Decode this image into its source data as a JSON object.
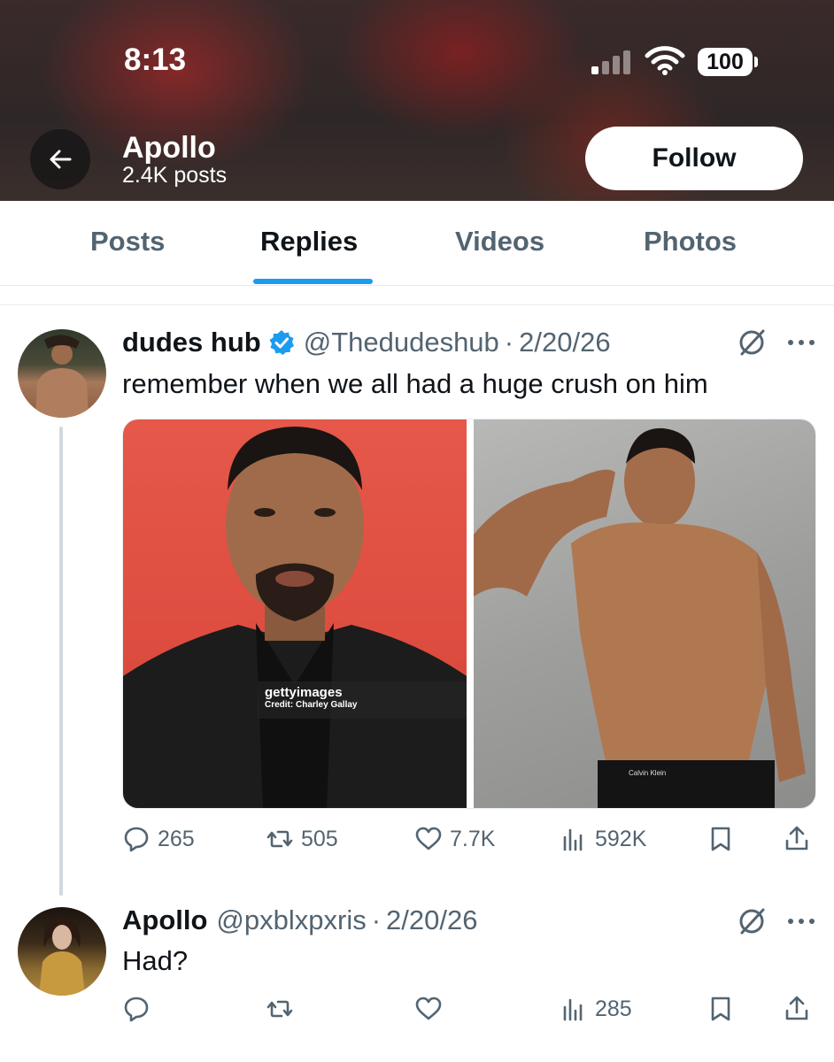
{
  "status_bar": {
    "time": "8:13",
    "battery": "100"
  },
  "header": {
    "name": "Apollo",
    "posts": "2.4K posts",
    "follow_label": "Follow"
  },
  "tabs": [
    {
      "label": "Posts",
      "active": false
    },
    {
      "label": "Replies",
      "active": true
    },
    {
      "label": "Videos",
      "active": false
    },
    {
      "label": "Photos",
      "active": false
    }
  ],
  "colors": {
    "accent": "#1d9bf0",
    "secondary_text": "#536471",
    "primary_text": "#0f1419"
  },
  "tweets": [
    {
      "name": "dudes hub",
      "verified": true,
      "handle": "@Thedudeshub",
      "date": "2/20/26",
      "text": "remember when we all had a huge crush on him",
      "media": {
        "watermark_brand": "gettyimages",
        "watermark_credit": "Credit: Charley Gallay",
        "waistband_text": "Calvin Klein"
      },
      "stats": {
        "replies": "265",
        "reposts": "505",
        "likes": "7.7K",
        "views": "592K"
      }
    },
    {
      "name": "Apollo",
      "verified": false,
      "handle": "@pxblxpxris",
      "date": "2/20/26",
      "text": "Had?",
      "stats": {
        "replies": "",
        "reposts": "",
        "likes": "",
        "views": "285"
      }
    }
  ],
  "icons": [
    "back-arrow-icon",
    "wifi-icon",
    "signal-icon",
    "battery-icon",
    "verified-badge-icon",
    "grok-icon",
    "more-icon",
    "reply-icon",
    "repost-icon",
    "like-icon",
    "views-icon",
    "bookmark-icon",
    "share-icon"
  ]
}
